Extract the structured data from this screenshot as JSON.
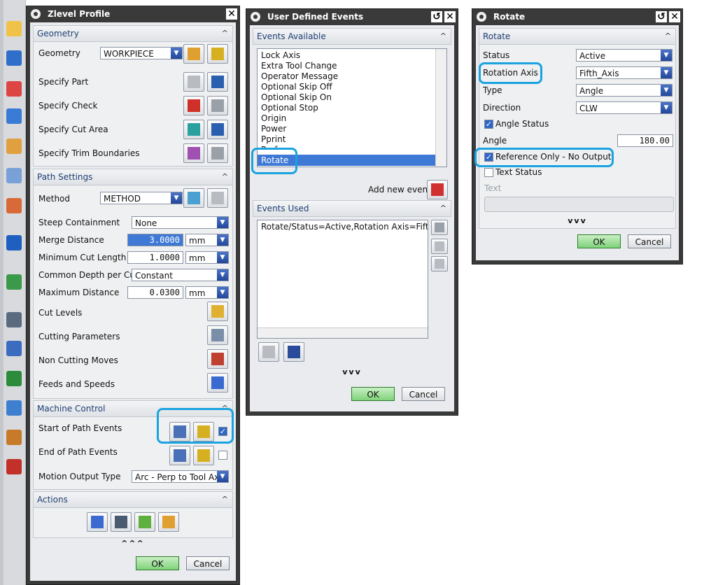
{
  "zlevel": {
    "title": "Zlevel Profile",
    "close": "✕",
    "geometry": {
      "header": "Geometry",
      "geometry_label": "Geometry",
      "geometry_value": "WORKPIECE",
      "specify_part": "Specify Part",
      "specify_check": "Specify Check",
      "specify_cut_area": "Specify Cut Area",
      "specify_trim": "Specify Trim Boundaries"
    },
    "path_settings": {
      "header": "Path Settings",
      "method_label": "Method",
      "method_value": "METHOD",
      "steep_label": "Steep Containment",
      "steep_value": "None",
      "merge_label": "Merge Distance",
      "merge_value": "3.0000",
      "merge_unit": "mm",
      "mincut_label": "Minimum Cut Length",
      "mincut_value": "1.0000",
      "mincut_unit": "mm",
      "depth_label": "Common Depth per Cut",
      "depth_value": "Constant",
      "maxdist_label": "Maximum Distance",
      "maxdist_value": "0.0300",
      "maxdist_unit": "mm",
      "cut_levels": "Cut Levels",
      "cutting_params": "Cutting Parameters",
      "non_cutting": "Non Cutting Moves",
      "feeds": "Feeds and Speeds"
    },
    "machine_control": {
      "header": "Machine Control",
      "start_events": "Start of Path Events",
      "end_events": "End of Path Events",
      "motion_label": "Motion Output Type",
      "motion_value": "Arc - Perp to Tool Axis"
    },
    "actions": {
      "header": "Actions",
      "more": "^^^"
    },
    "ok": "OK",
    "cancel": "Cancel"
  },
  "ude": {
    "title": "User Defined Events",
    "reset": "↺",
    "close": "✕",
    "available_header": "Events Available",
    "available": [
      "Lock Axis",
      "Extra Tool Change",
      "Operator Message",
      "Optional Skip Off",
      "Optional Skip On",
      "Optional Stop",
      "Origin",
      "Power",
      "Pprint",
      "Prefun",
      "Rotate"
    ],
    "add_new_event": "Add new event",
    "used_header": "Events Used",
    "used_item": "Rotate/Status=Active,Rotation Axis=Fifth_Axis,",
    "more": "vvv",
    "ok": "OK",
    "cancel": "Cancel"
  },
  "rotate": {
    "title": "Rotate",
    "reset": "↺",
    "close": "✕",
    "header": "Rotate",
    "status_label": "Status",
    "status_value": "Active",
    "axis_label": "Rotation Axis",
    "axis_value": "Fifth_Axis",
    "type_label": "Type",
    "type_value": "Angle",
    "direction_label": "Direction",
    "direction_value": "CLW",
    "angle_status": "Angle Status",
    "angle_label": "Angle",
    "angle_value": "180.00",
    "ref_only": "Reference Only - No Output",
    "text_status": "Text Status",
    "text_label": "Text",
    "more": "vvv",
    "ok": "OK",
    "cancel": "Cancel"
  },
  "colors": {
    "highlight": "#1aa3e0",
    "ok_green": "#7fd27a",
    "selection_blue": "#3e79d6"
  }
}
